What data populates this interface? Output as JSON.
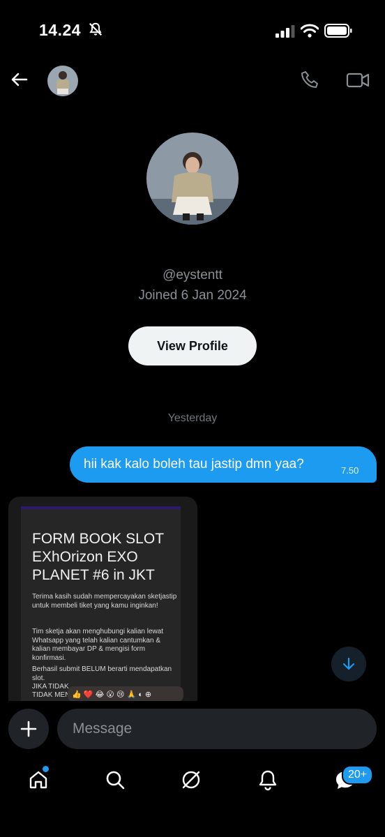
{
  "status_bar": {
    "time": "14.24"
  },
  "profile": {
    "handle": "@eystentt",
    "joined": "Joined 6 Jan 2024",
    "view_profile_label": "View Profile"
  },
  "conversation": {
    "day_separator": "Yesterday",
    "sent_message": {
      "text": "hii kak kalo boleh tau jastip dmn yaa?",
      "time": "7.50"
    },
    "shared_card": {
      "title": "FORM BOOK SLOT EXhOrizon EXO PLANET #6 in JKT",
      "paragraphs": [
        "Terima kasih sudah mempercayakan sketjastip untuk membeli tiket yang kamu inginkan!",
        "Tim sketja akan menghubungi kalian lewat Whatsapp yang telah kalian cantumkan & kalian membayar DP & mengisi form konfirmasi.",
        "Berhasil submit BELUM berarti mendapatkan slot.",
        "JIKA TIDAK",
        "TIDAK MEN"
      ],
      "reactions": "👍 ❤️ 😂 😮 😢 🙏 ◐ ⊕"
    }
  },
  "composer": {
    "placeholder": "Message"
  },
  "tab_bar": {
    "items": [
      "home",
      "search",
      "grok",
      "notifications",
      "messages"
    ],
    "messages_badge": "20+"
  },
  "colors": {
    "accent": "#1d9bf0",
    "background": "#000000",
    "muted": "#8b9096"
  }
}
